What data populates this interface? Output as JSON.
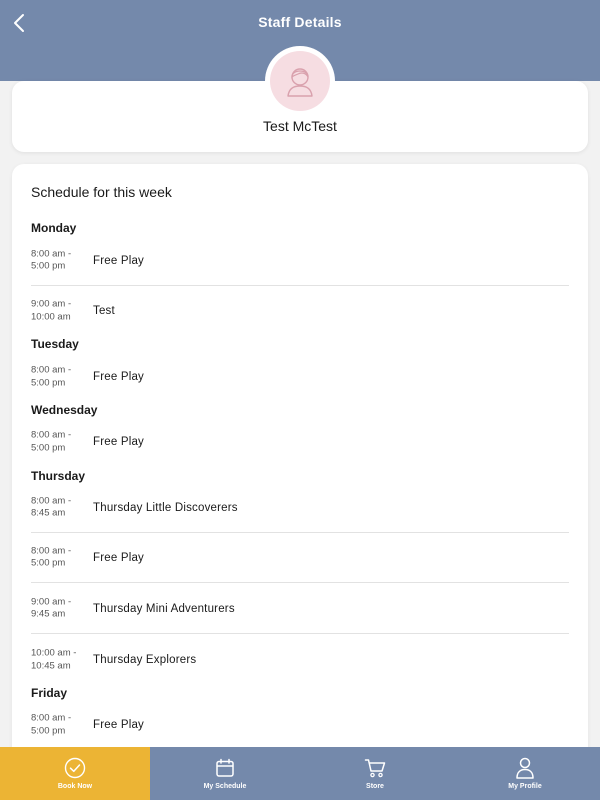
{
  "header": {
    "title": "Staff Details"
  },
  "profile": {
    "name": "Test McTest"
  },
  "schedule": {
    "title": "Schedule for this week",
    "days": [
      {
        "name": "Monday",
        "entries": [
          {
            "time_start": "8:00 am -",
            "time_end": "5:00 pm",
            "activity": "Free Play"
          },
          {
            "time_start": "9:00 am -",
            "time_end": "10:00 am",
            "activity": "Test"
          }
        ]
      },
      {
        "name": "Tuesday",
        "entries": [
          {
            "time_start": "8:00 am -",
            "time_end": "5:00 pm",
            "activity": "Free Play"
          }
        ]
      },
      {
        "name": "Wednesday",
        "entries": [
          {
            "time_start": "8:00 am -",
            "time_end": "5:00 pm",
            "activity": "Free Play"
          }
        ]
      },
      {
        "name": "Thursday",
        "entries": [
          {
            "time_start": "8:00 am -",
            "time_end": "8:45 am",
            "activity": "Thursday Little Discoverers"
          },
          {
            "time_start": "8:00 am -",
            "time_end": "5:00 pm",
            "activity": "Free Play"
          },
          {
            "time_start": "9:00 am -",
            "time_end": "9:45 am",
            "activity": "Thursday Mini Adventurers"
          },
          {
            "time_start": "10:00 am -",
            "time_end": "10:45 am",
            "activity": "Thursday Explorers"
          }
        ]
      },
      {
        "name": "Friday",
        "entries": [
          {
            "time_start": "8:00 am -",
            "time_end": "5:00 pm",
            "activity": "Free Play"
          }
        ]
      }
    ]
  },
  "nav": {
    "items": [
      {
        "label": "Book Now",
        "icon": "check-circle-icon",
        "active": true
      },
      {
        "label": "My Schedule",
        "icon": "calendar-icon",
        "active": false
      },
      {
        "label": "Store",
        "icon": "cart-icon",
        "active": false
      },
      {
        "label": "My Profile",
        "icon": "person-icon",
        "active": false
      }
    ]
  },
  "colors": {
    "header": "#7489ab",
    "nav_active": "#ecb434",
    "avatar_bg": "#f6dde2"
  }
}
